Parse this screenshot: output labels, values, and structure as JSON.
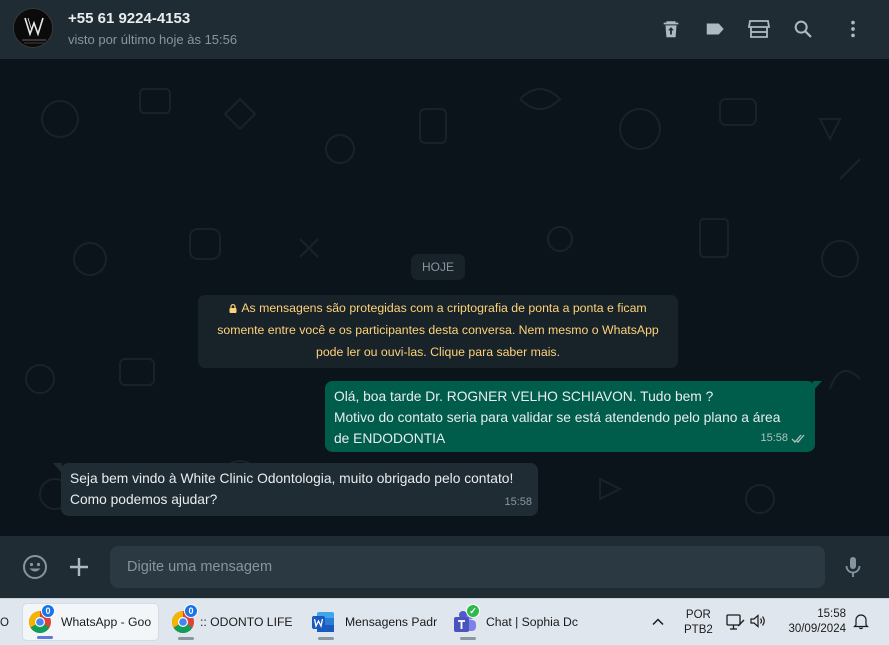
{
  "header": {
    "avatar_text": "WHITE CLINIC",
    "contact_name": "+55 61 9224-4153",
    "contact_status": "visto por último hoje às 15:56",
    "icons": [
      "trash-upload-icon",
      "label-icon",
      "store-icon",
      "search-icon",
      "menu-dots-icon"
    ]
  },
  "chat": {
    "date_chip": "HOJE",
    "encryption_notice": "As mensagens são protegidas com a criptografia de ponta a ponta e ficam somente entre você e os participantes desta conversa. Nem mesmo o WhatsApp pode ler ou ouvi-las. Clique para saber mais.",
    "encryption_lines": [
      "As mensagens são protegidas com a criptografia de ponta a ponta e ficam",
      "somente entre você e os participantes desta conversa. Nem mesmo o WhatsApp",
      "pode ler ou ouvi-las. Clique para saber mais."
    ],
    "messages": [
      {
        "direction": "outgoing",
        "lines": [
          "Olá, boa tarde Dr. ROGNER VELHO SCHIAVON. Tudo bem ?",
          "Motivo do contato seria para validar se está atendendo pelo plano a área",
          "de ENDODONTIA"
        ],
        "time": "15:58",
        "status": "read-ticks"
      },
      {
        "direction": "incoming",
        "lines": [
          "Seja bem vindo à White Clinic Odontologia, muito obrigado pelo contato!",
          "Como podemos ajudar?"
        ],
        "time": "15:58"
      }
    ]
  },
  "composer": {
    "placeholder": "Digite uma mensagem"
  },
  "taskbar": {
    "left_edge_text": "O",
    "items": [
      {
        "label": "WhatsApp - Goo",
        "badge": "0",
        "active": true
      },
      {
        "label": ":: ODONTO LIFE",
        "badge": "0",
        "active": false
      },
      {
        "label": "Mensagens Padr",
        "active": false
      },
      {
        "label": "Chat | Sophia Dc",
        "active": false
      }
    ],
    "language_top": "POR",
    "language_bottom": "PTB2",
    "clock_time": "15:58",
    "clock_date": "30/09/2024"
  },
  "colors": {
    "outgoing_bubble": "#005c4b",
    "incoming_bubble": "#202c33",
    "header": "#202c33",
    "chat_background": "#0b141a",
    "notice_text": "#ffd279"
  }
}
